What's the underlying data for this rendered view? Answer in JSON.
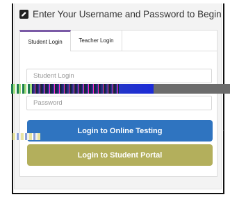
{
  "header": {
    "icon": "edit-icon",
    "title": "Enter Your Username and Password to Begin"
  },
  "tabs": [
    {
      "label": "Student Login",
      "active": true
    },
    {
      "label": "Teacher Login",
      "active": false
    }
  ],
  "form": {
    "username_placeholder": "Student Login",
    "username_value": "",
    "password_placeholder": "Password",
    "password_value": ""
  },
  "buttons": {
    "online_testing": "Login to Online Testing",
    "student_portal": "Login to Student Portal"
  },
  "colors": {
    "active_tab_accent": "#7a5aa6",
    "online_button": "#2f74c0",
    "portal_button": "#b3af5c"
  }
}
